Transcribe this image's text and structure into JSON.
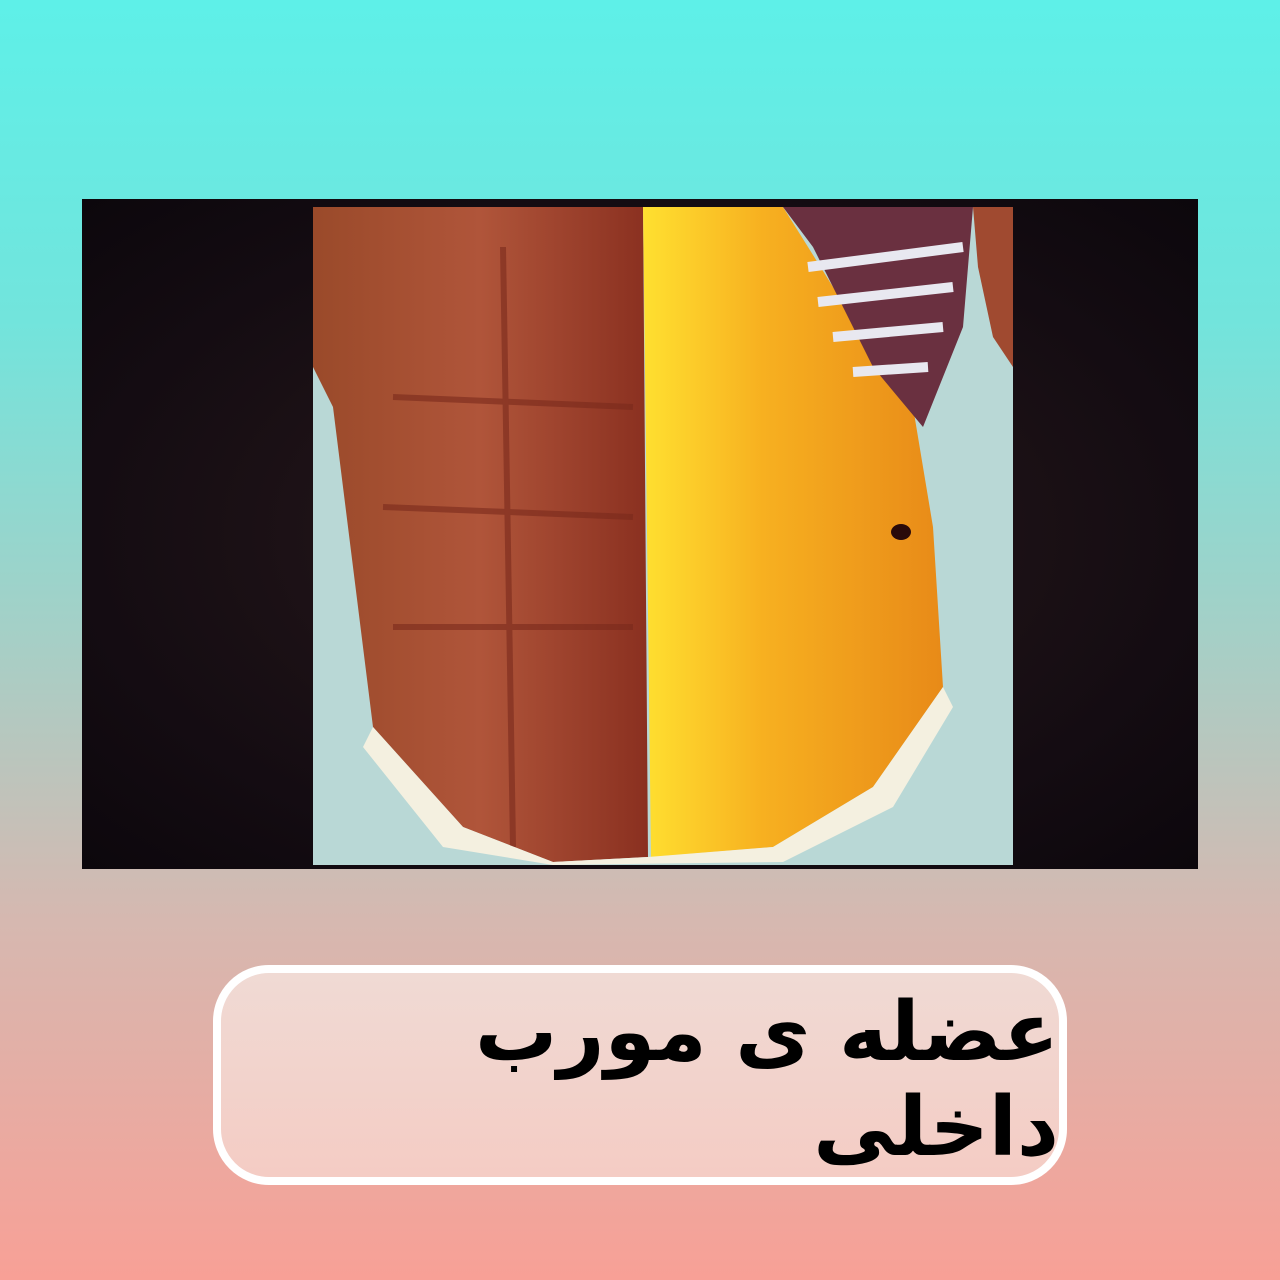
{
  "caption": {
    "text": "عضله ی مورب داخلی"
  },
  "colors": {
    "background_top": "#5ef0e8",
    "background_bottom": "#f8a096",
    "caption_fill": "#f2d6d0",
    "caption_border": "#ffffff",
    "muscle_highlight": "#f5b020"
  },
  "image": {
    "subject": "abdominal-muscles-illustration"
  }
}
